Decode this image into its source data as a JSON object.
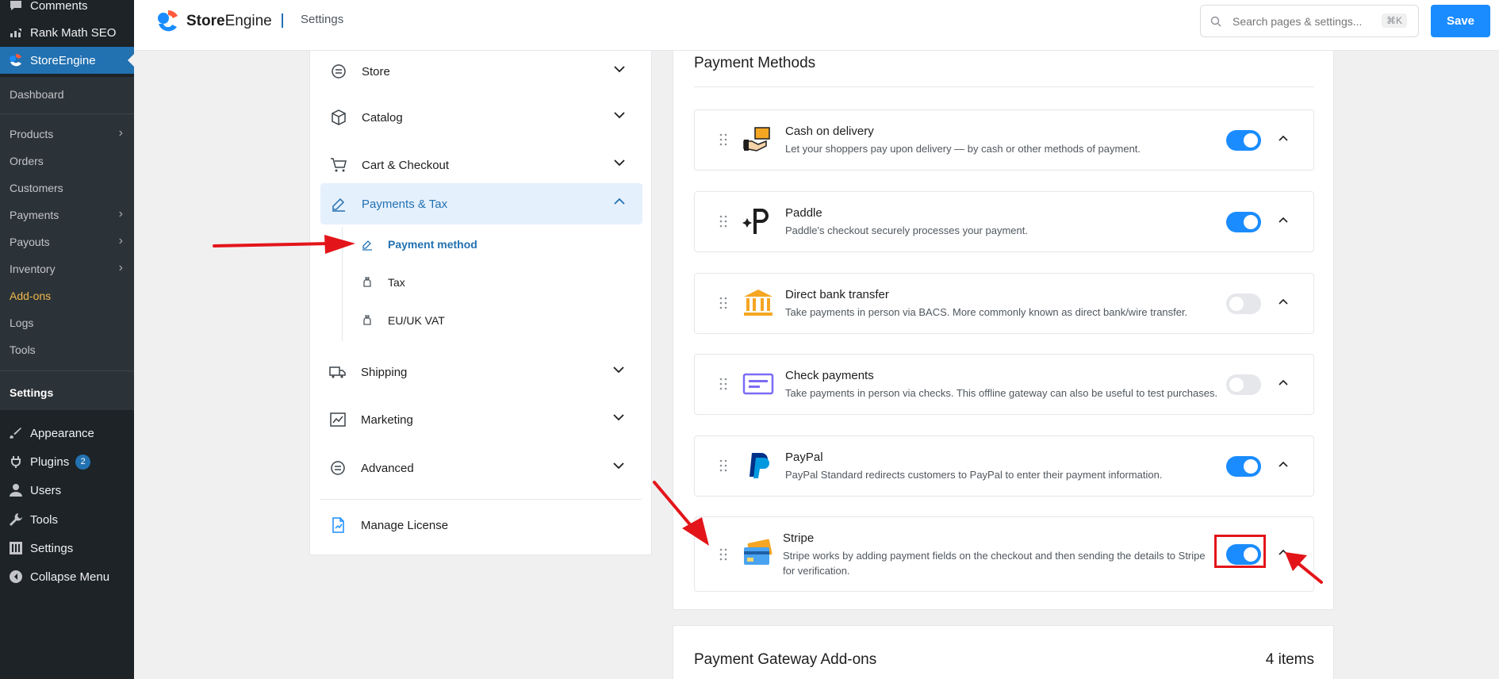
{
  "wp_sidebar": {
    "items_top": [
      {
        "label": "Comments",
        "icon": "comments-icon"
      },
      {
        "label": "Rank Math SEO",
        "icon": "rank-math-icon"
      },
      {
        "label": "StoreEngine",
        "icon": "storeengine-icon"
      }
    ],
    "submenu": [
      {
        "label": "Dashboard"
      },
      {
        "label": "Products",
        "has_children": true
      },
      {
        "label": "Orders"
      },
      {
        "label": "Customers"
      },
      {
        "label": "Payments",
        "has_children": true
      },
      {
        "label": "Payouts",
        "has_children": true
      },
      {
        "label": "Inventory",
        "has_children": true
      },
      {
        "label": "Add-ons"
      },
      {
        "label": "Logs"
      },
      {
        "label": "Tools"
      },
      {
        "label": "Settings"
      }
    ],
    "items_bottom": [
      {
        "label": "Appearance",
        "icon": "brush-icon"
      },
      {
        "label": "Plugins",
        "icon": "plugin-icon",
        "badge": "2"
      },
      {
        "label": "Users",
        "icon": "user-icon"
      },
      {
        "label": "Tools",
        "icon": "wrench-icon"
      },
      {
        "label": "Settings",
        "icon": "sliders-icon"
      },
      {
        "label": "Collapse Menu",
        "icon": "collapse-icon"
      }
    ]
  },
  "header": {
    "brand_bold": "Store",
    "brand_rest": "Engine",
    "page": "Settings",
    "search_placeholder": "Search pages & settings...",
    "shortcut": "⌘K",
    "save_label": "Save"
  },
  "settings_nav": {
    "items": [
      {
        "label": "Store",
        "icon": "store-icon",
        "expanded": false
      },
      {
        "label": "Catalog",
        "icon": "box-icon",
        "expanded": false
      },
      {
        "label": "Cart & Checkout",
        "icon": "cart-icon",
        "expanded": false
      },
      {
        "label": "Payments & Tax",
        "icon": "payments-icon",
        "expanded": true
      },
      {
        "label": "Shipping",
        "icon": "truck-icon",
        "expanded": false
      },
      {
        "label": "Marketing",
        "icon": "chart-icon",
        "expanded": false
      },
      {
        "label": "Advanced",
        "icon": "advanced-icon",
        "expanded": false
      },
      {
        "label": "Manage License",
        "icon": "license-icon"
      }
    ],
    "subitems": [
      {
        "label": "Payment method",
        "current": true
      },
      {
        "label": "Tax"
      },
      {
        "label": "EU/UK VAT"
      }
    ]
  },
  "payment_methods": {
    "title": "Payment Methods",
    "items": [
      {
        "name": "Cash on delivery",
        "desc": "Let your shoppers pay upon delivery — by cash or other methods of payment.",
        "enabled": true,
        "icon": "cash-delivery-icon"
      },
      {
        "name": "Paddle",
        "desc": "Paddle's checkout securely processes your payment.",
        "enabled": true,
        "icon": "paddle-icon"
      },
      {
        "name": "Direct bank transfer",
        "desc": "Take payments in person via BACS. More commonly known as direct bank/wire transfer.",
        "enabled": false,
        "icon": "bank-icon"
      },
      {
        "name": "Check payments",
        "desc": "Take payments in person via checks. This offline gateway can also be useful to test purchases.",
        "enabled": false,
        "icon": "check-icon"
      },
      {
        "name": "PayPal",
        "desc": "PayPal Standard redirects customers to PayPal to enter their payment information.",
        "enabled": true,
        "icon": "paypal-icon"
      },
      {
        "name": "Stripe",
        "desc": "Stripe works by adding payment fields on the checkout and then sending the details to Stripe for verification.",
        "enabled": true,
        "icon": "stripe-card-icon"
      }
    ]
  },
  "addons": {
    "title": "Payment Gateway Add-ons",
    "count": "4 items"
  },
  "colors": {
    "accent": "#1a8cff",
    "wp_sidebar": "#1d2327",
    "annotation": "#e3151a"
  }
}
